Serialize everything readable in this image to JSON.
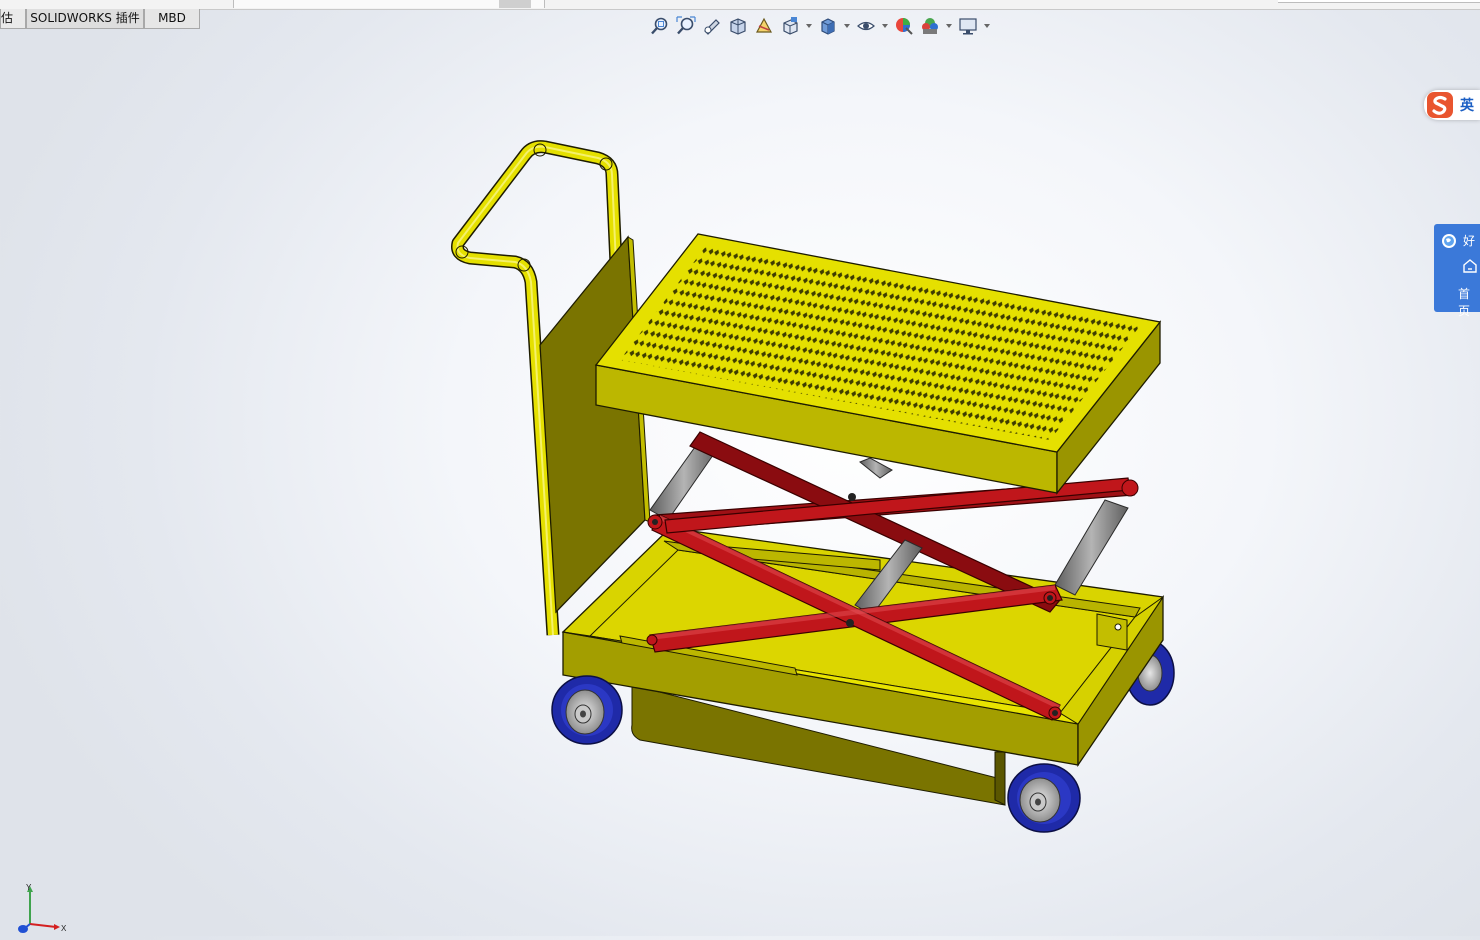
{
  "app": {
    "name": "SOLIDWORKS"
  },
  "tabs": [
    {
      "label": "估"
    },
    {
      "label": "SOLIDWORKS 插件"
    },
    {
      "label": "MBD"
    }
  ],
  "heads_up_toolbar": {
    "icons": [
      "zoom-to-fit-icon",
      "zoom-area-icon",
      "previous-view-icon",
      "section-view-icon",
      "dynamic-annotation-icon",
      "view-orientation-icon",
      "display-style-icon",
      "hide-show-icon",
      "edit-appearance-icon",
      "apply-scene-icon",
      "view-settings-icon"
    ]
  },
  "ime": {
    "lang_label": "英"
  },
  "side_panel": {
    "title": "好",
    "home_label": "首页"
  },
  "triad": {
    "x_label": "X",
    "y_label": "Y"
  },
  "model": {
    "name": "scissor lift cart",
    "colors": {
      "frame": "#e5e000",
      "frame_dark": "#7a7400",
      "scissor": "#c0161b",
      "wheel_tire": "#1f2aa8",
      "wheel_hub": "#b9b9b9",
      "roller": "#8c8c8c"
    }
  }
}
